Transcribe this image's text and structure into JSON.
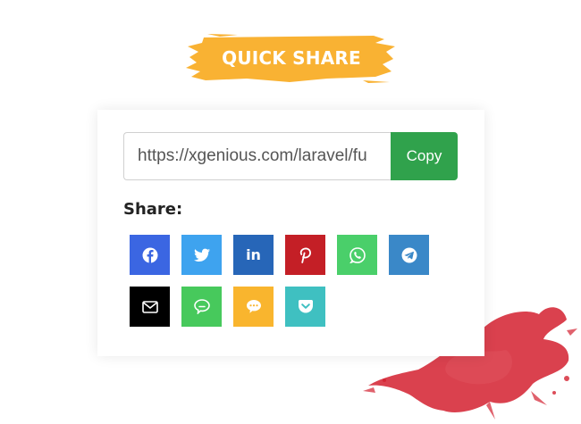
{
  "banner": {
    "title": "QUICK SHARE",
    "color": "#f9b233"
  },
  "share_box": {
    "url_value": "https://xgenious.com/laravel/fu",
    "copy_label": "Copy",
    "share_label": "Share:"
  },
  "share_buttons": [
    {
      "icon": "facebook-icon",
      "color": "#3b66e2"
    },
    {
      "icon": "twitter-icon",
      "color": "#3ea3ef"
    },
    {
      "icon": "linkedin-icon",
      "color": "#2766b8"
    },
    {
      "icon": "pinterest-icon",
      "color": "#c41f26"
    },
    {
      "icon": "whatsapp-icon",
      "color": "#4acf6a"
    },
    {
      "icon": "telegram-icon",
      "color": "#3a88c8"
    },
    {
      "icon": "email-icon",
      "color": "#000000"
    },
    {
      "icon": "line-icon",
      "color": "#47c95c"
    },
    {
      "icon": "sms-icon",
      "color": "#f9b52e"
    },
    {
      "icon": "pocket-icon",
      "color": "#3fc0c1"
    }
  ],
  "colors": {
    "copy_button": "#30a24c",
    "splash": "#d3202f"
  }
}
